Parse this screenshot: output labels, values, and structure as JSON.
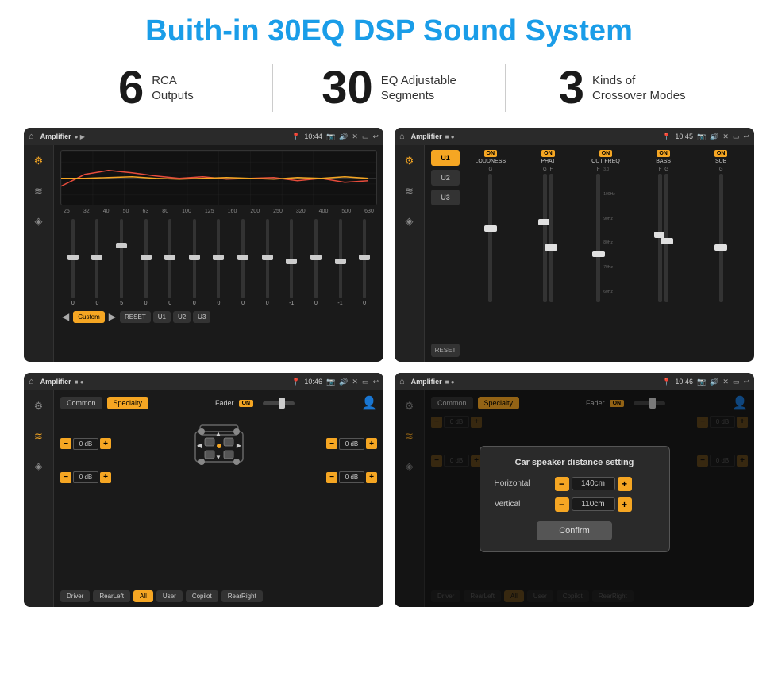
{
  "header": {
    "title": "Buith-in 30EQ DSP Sound System"
  },
  "stats": [
    {
      "number": "6",
      "line1": "RCA",
      "line2": "Outputs"
    },
    {
      "number": "30",
      "line1": "EQ Adjustable",
      "line2": "Segments"
    },
    {
      "number": "3",
      "line1": "Kinds of",
      "line2": "Crossover Modes"
    }
  ],
  "screens": [
    {
      "id": "eq-screen",
      "topbar": {
        "time": "10:44",
        "title": "Amplifier"
      },
      "eq_labels": [
        "25",
        "32",
        "40",
        "50",
        "63",
        "80",
        "100",
        "125",
        "160",
        "200",
        "250",
        "320",
        "400",
        "500",
        "630"
      ],
      "eq_values": [
        "0",
        "0",
        "0",
        "5",
        "0",
        "0",
        "0",
        "0",
        "0",
        "0",
        "-1",
        "0",
        "-1"
      ],
      "preset_label": "Custom",
      "buttons": [
        "RESET",
        "U1",
        "U2",
        "U3"
      ]
    },
    {
      "id": "crossover-screen",
      "topbar": {
        "time": "10:45",
        "title": "Amplifier"
      },
      "presets": [
        "U1",
        "U2",
        "U3"
      ],
      "channels": [
        "LOUDNESS",
        "PHAT",
        "CUT FREQ",
        "BASS",
        "SUB"
      ]
    },
    {
      "id": "fader-screen",
      "topbar": {
        "time": "10:46",
        "title": "Amplifier"
      },
      "tabs": [
        "Common",
        "Specialty"
      ],
      "fader_label": "Fader",
      "on_label": "ON",
      "speaker_positions": {
        "fl": "0 dB",
        "fr": "0 dB",
        "rl": "0 dB",
        "rr": "0 dB"
      },
      "locations": [
        "Driver",
        "RearLeft",
        "All",
        "User",
        "Copilot",
        "RearRight"
      ]
    },
    {
      "id": "dialog-screen",
      "topbar": {
        "time": "10:46",
        "title": "Amplifier"
      },
      "tabs": [
        "Common",
        "Specialty"
      ],
      "dialog": {
        "title": "Car speaker distance setting",
        "rows": [
          {
            "label": "Horizontal",
            "value": "140cm"
          },
          {
            "label": "Vertical",
            "value": "110cm"
          }
        ],
        "confirm_label": "Confirm"
      }
    }
  ]
}
